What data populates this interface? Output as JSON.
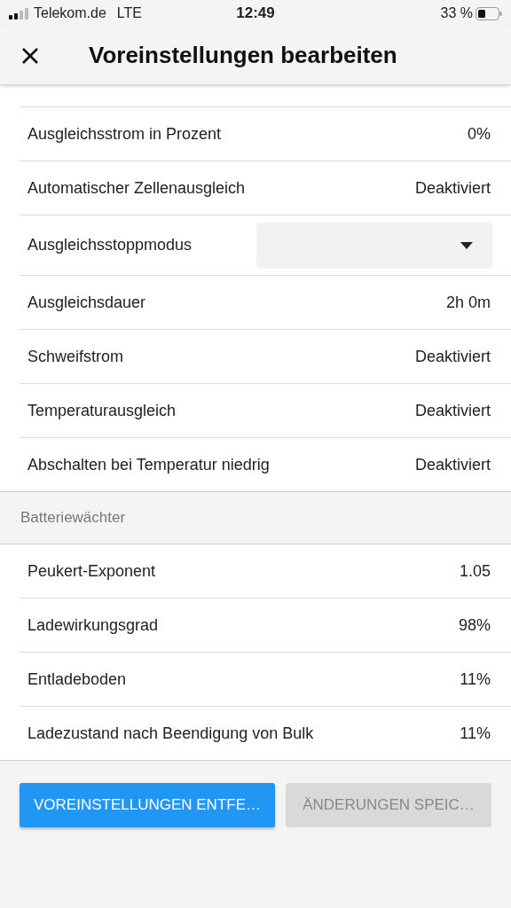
{
  "status_bar": {
    "carrier": "Telekom.de",
    "network": "LTE",
    "time": "12:49",
    "battery": "33 %"
  },
  "header": {
    "title": "Voreinstellungen bearbeiten"
  },
  "rows": [
    {
      "kind": "value",
      "label": "Ausgleichsstrom in Prozent",
      "value": "0%"
    },
    {
      "kind": "value",
      "label": "Automatischer Zellenausgleich",
      "value": "Deaktiviert"
    },
    {
      "kind": "dropdown",
      "label": "Ausgleichsstoppmodus"
    },
    {
      "kind": "value",
      "label": "Ausgleichsdauer",
      "value": "2h 0m"
    },
    {
      "kind": "value",
      "label": "Schweifstrom",
      "value": "Deaktiviert"
    },
    {
      "kind": "value",
      "label": "Temperaturausgleich",
      "value": "Deaktiviert"
    },
    {
      "kind": "value",
      "label": "Abschalten bei Temperatur niedrig",
      "value": "Deaktiviert"
    }
  ],
  "section": {
    "title": "Batteriewächter",
    "rows": [
      {
        "kind": "value",
        "label": "Peukert-Exponent",
        "value": "1.05"
      },
      {
        "kind": "value",
        "label": "Ladewirkungsgrad",
        "value": "98%"
      },
      {
        "kind": "value",
        "label": "Entladeboden",
        "value": "11%"
      },
      {
        "kind": "value",
        "label": "Ladezustand nach Beendigung von Bulk",
        "value": "11%"
      }
    ]
  },
  "buttons": [
    {
      "label": "VOREINSTELLUNGEN ENTFE…",
      "disabled": false
    },
    {
      "label": "ÄNDERUNGEN SPEIC…",
      "disabled": true
    }
  ]
}
